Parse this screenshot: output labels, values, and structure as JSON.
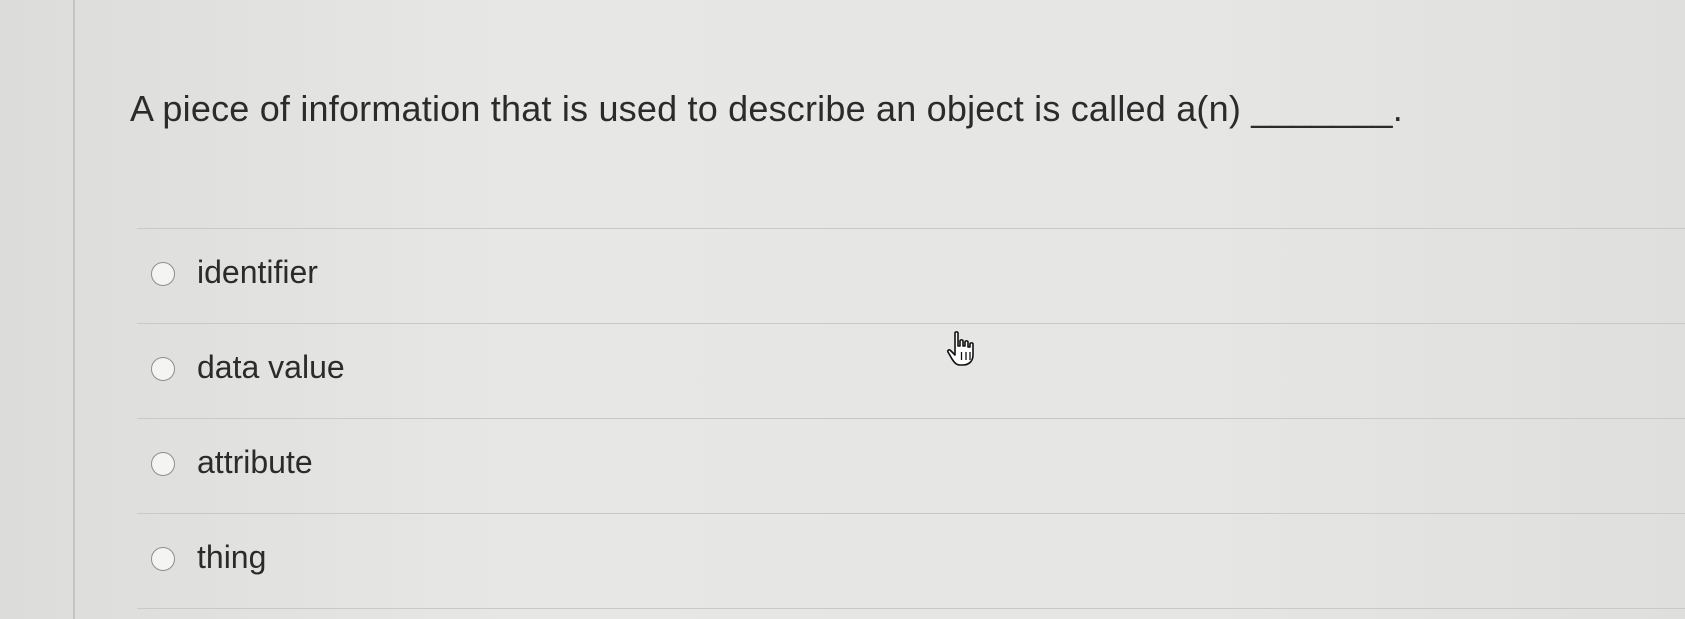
{
  "question": {
    "text": "A piece of information that is used to describe an object is called a(n) _______."
  },
  "options": [
    {
      "label": "identifier",
      "selected": false
    },
    {
      "label": "data value",
      "selected": false
    },
    {
      "label": "attribute",
      "selected": false
    },
    {
      "label": "thing",
      "selected": false
    }
  ],
  "cursor": {
    "icon": "hand-pointer-icon"
  }
}
